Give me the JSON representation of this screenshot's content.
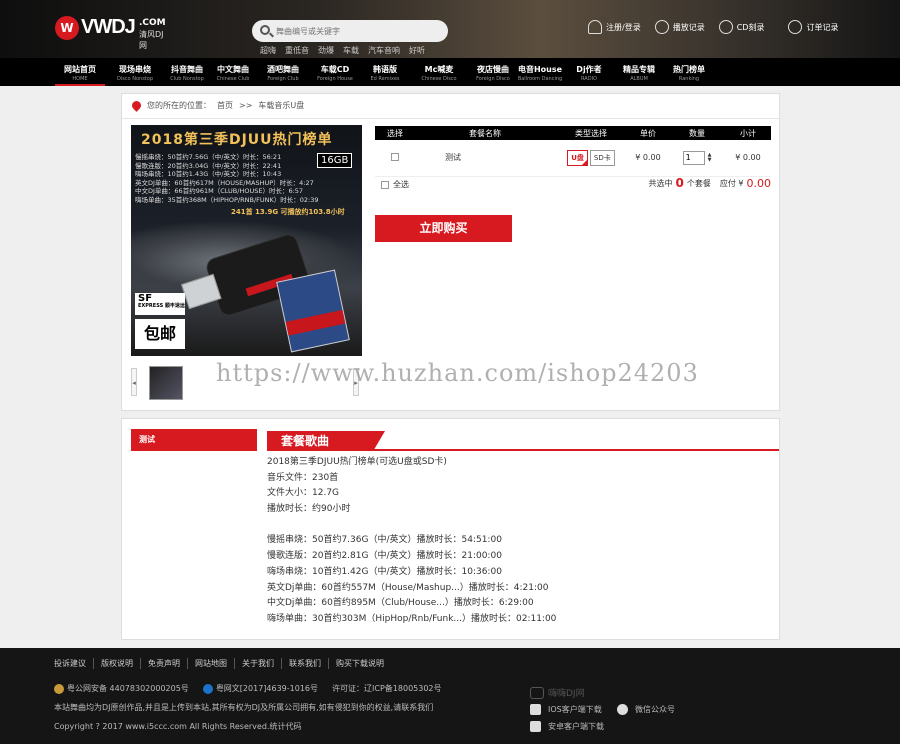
{
  "header": {
    "logo_main": "VWDJ",
    "logo_com": ".COM",
    "logo_sub": "清风DJ网",
    "search_placeholder": "舞曲编号或关键字",
    "hotwords": [
      "超嗨",
      "重低音",
      "劲爆",
      "车载",
      "汽车音响",
      "好听"
    ],
    "toplinks": [
      {
        "label": "注册/登录",
        "icon": "user-icon"
      },
      {
        "label": "播放记录",
        "icon": "clock-icon"
      },
      {
        "label": "CD刻录",
        "icon": "cd-icon"
      },
      {
        "label": "订单记录",
        "icon": "order-icon"
      }
    ]
  },
  "nav": [
    {
      "cn": "网站首页",
      "en": "HOME"
    },
    {
      "cn": "现场串烧",
      "en": "Disco Nonstop"
    },
    {
      "cn": "抖音舞曲",
      "en": "Club Nonstop"
    },
    {
      "cn": "中文舞曲",
      "en": "Chinese Club"
    },
    {
      "cn": "酒吧舞曲",
      "en": "Foreign Club"
    },
    {
      "cn": "车载CD",
      "en": "Foreign House"
    },
    {
      "cn": "韩语版",
      "en": "Ed Remixes"
    },
    {
      "cn": "Mc喊麦",
      "en": "Chinese Disco"
    },
    {
      "cn": "夜店慢曲",
      "en": "Foreign Disco"
    },
    {
      "cn": "电音House",
      "en": "Ballroom Dancing"
    },
    {
      "cn": "Dj作者",
      "en": "RADIO"
    },
    {
      "cn": "精品专辑",
      "en": "ALBUM"
    },
    {
      "cn": "热门榜单",
      "en": "Ranking"
    }
  ],
  "breadcrumb": {
    "prefix": "您的所在的位置：",
    "home": "首页",
    "sep": ">>",
    "current": "车载音乐U盘"
  },
  "product_image": {
    "title": "2018第三季DJUU热门榜单",
    "lines": [
      "慢摇串烧：50首约7.56G（中/英文）时长：56:21",
      "慢歌连版：20首约3.04G（中/英文）时长：22:41",
      "嗨场串烧：10首约1.43G（中/英文）时长：10:43",
      "英文DJ单曲：60首约617M（HOUSE/MASHUP）时长：4:27",
      "中文DJ单曲：66首约961M（CLUB/HOUSE）时长：6:57",
      "嗨场单曲：35首约368M（HIPHOP/RNB/FUNK）时长：02:39"
    ],
    "capacity": "16GB",
    "total": "241首 13.9G 可播放约103.8小时",
    "sf": "SF",
    "sf_sub": "EXPRESS 顺丰速运",
    "baoyou": "包邮"
  },
  "thumbs": {
    "prev": "◂",
    "next": "▸"
  },
  "watermark": "https://www.huzhan.com/ishop24203",
  "cart": {
    "headers": [
      "选择",
      "套餐名称",
      "类型选择",
      "单价",
      "数量",
      "小计"
    ],
    "row": {
      "name": "测试",
      "types": [
        "U盘",
        "SD卡"
      ],
      "price": "¥ 0.00",
      "qty": "1",
      "subtotal": "¥ 0.00"
    },
    "select_all": "全选",
    "total_prefix": "共选中",
    "total_count": "0",
    "total_suffix": "个套餐",
    "pay_label": "应付 ¥",
    "pay_amount": "0.00",
    "buy_label": "立即购买"
  },
  "detail": {
    "tab": "测试",
    "section_title": "套餐歌曲",
    "lines": [
      "2018第三季DJUU热门榜单(可选U盘或SD卡)",
      "音乐文件：230首",
      "文件大小：12.7G",
      "播放时长：约90小时",
      "",
      "慢摇串烧：50首约7.36G（中/英文）播放时长：54:51:00",
      "慢歌连版：20首约2.81G（中/英文）播放时长：21:00:00",
      "嗨场串烧：10首约1.42G（中/英文）播放时长：10:36:00",
      "英文Dj单曲：60首约557M（House/Mashup...）播放时长：4:21:00",
      "中文Dj单曲：60首约895M（Club/House...）播放时长：6:29:00",
      "嗨场单曲：30首约303M（HipHop/Rnb/Funk...）播放时长：02:11:00"
    ]
  },
  "footer": {
    "links": [
      "投诉建议",
      "版权说明",
      "免责声明",
      "网站地图",
      "关于我们",
      "联系我们",
      "购买下载说明"
    ],
    "icp1": "粤公网安备 44078302000205号",
    "icp2": "粤网文[2017]4639-1016号",
    "icp3": "许可证：辽ICP备18005302号",
    "notice": "本站舞曲均为DJ原创作品,并且是上传到本站,其所有权为DJ及所属公司拥有,如有侵犯到你的权益,请联系我们",
    "copyright": "Copyright ? 2017 www.i5ccc.com All Rights Reserved.统计代码",
    "brand": "嗨嗨DJ网",
    "ios": "IOS客户端下载",
    "wechat": "微信公众号",
    "android": "安卓客户端下载"
  }
}
